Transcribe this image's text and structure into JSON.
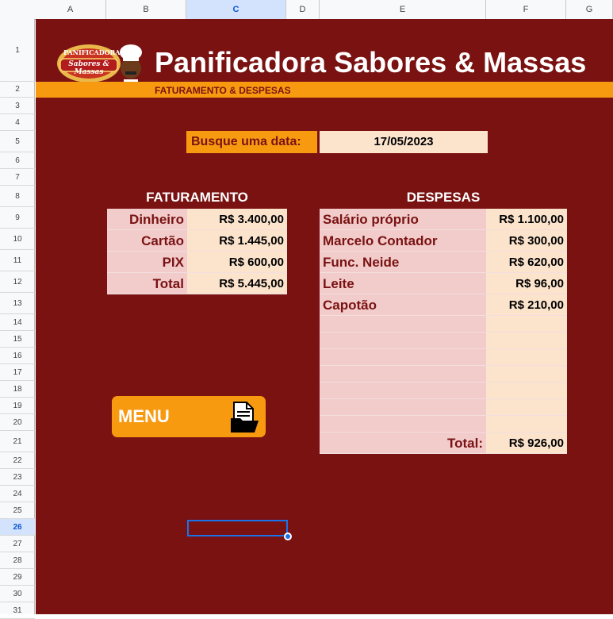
{
  "columns": [
    "A",
    "B",
    "C",
    "D",
    "E",
    "F",
    "G"
  ],
  "selected_column": "C",
  "rows": [
    "1",
    "2",
    "3",
    "4",
    "5",
    "6",
    "7",
    "8",
    "9",
    "10",
    "11",
    "12",
    "13",
    "14",
    "15",
    "16",
    "17",
    "18",
    "19",
    "20",
    "21",
    "22",
    "23",
    "24",
    "25",
    "26",
    "27",
    "28",
    "29",
    "30",
    "31"
  ],
  "selected_row": "26",
  "header": {
    "title": "Panificadora Sabores & Massas",
    "subtitle": "FATURAMENTO & DESPESAS",
    "logo": {
      "top": "PANIFICADORA",
      "name": "Sabores & Massas",
      "phone": "99621-4045"
    }
  },
  "search": {
    "label": "Busque uma data:",
    "value": "17/05/2023"
  },
  "faturamento": {
    "title": "FATURAMENTO",
    "rows": [
      {
        "label": "Dinheiro",
        "value": "R$ 3.400,00"
      },
      {
        "label": "Cartão",
        "value": "R$ 1.445,00"
      },
      {
        "label": "PIX",
        "value": "R$ 600,00"
      },
      {
        "label": "Total",
        "value": "R$ 5.445,00"
      }
    ]
  },
  "despesas": {
    "title": "DESPESAS",
    "rows": [
      {
        "label": "Salário próprio",
        "value": "R$ 1.100,00"
      },
      {
        "label": "Marcelo Contador",
        "value": "R$ 300,00"
      },
      {
        "label": "Func. Neide",
        "value": "R$ 620,00"
      },
      {
        "label": "Leite",
        "value": "R$ 96,00"
      },
      {
        "label": "Capotão",
        "value": "R$ 210,00"
      }
    ],
    "total_label": "Total:",
    "total_value": "R$ 926,00"
  },
  "menu": {
    "label": "MENU",
    "icon": "folder-document-icon"
  },
  "colors": {
    "background": "#7a1212",
    "accent": "#f89a10",
    "label_bg": "#f2cbcb",
    "value_bg": "#fbe3cc"
  }
}
